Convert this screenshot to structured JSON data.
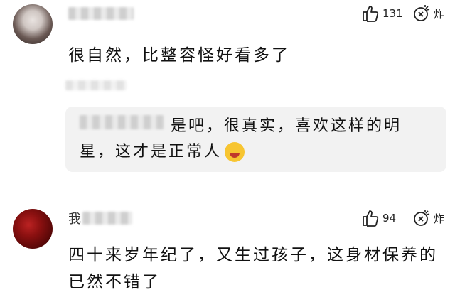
{
  "comments": [
    {
      "username_prefix": "",
      "likes": "131",
      "dislike_label": "炸",
      "text": "很自然，比整容怪好看多了",
      "reply": {
        "text": "是吧，很真实，喜欢这样的明星，这才是正常人"
      }
    },
    {
      "username_prefix": "我",
      "likes": "94",
      "dislike_label": "炸",
      "text": "四十来岁年纪了，又生过孩子，这身材保养的已然不错了"
    }
  ],
  "icons": {
    "like": "thumbs-up-icon",
    "dislike": "bomb-icon",
    "emoji": "laughing-emoji-icon"
  }
}
